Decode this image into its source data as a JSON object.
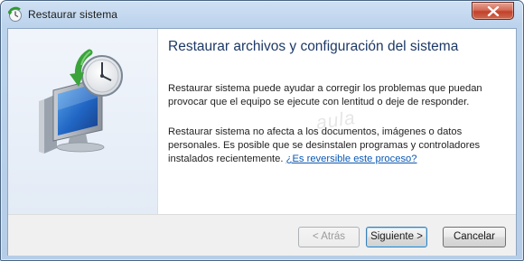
{
  "window": {
    "title": "Restaurar sistema"
  },
  "content": {
    "heading": "Restaurar archivos y configuración del sistema",
    "para1": "Restaurar sistema puede ayudar a corregir los problemas que puedan provocar que el equipo se ejecute con lentitud o deje de responder.",
    "para2_text": "Restaurar sistema no afecta a los documentos, imágenes o datos personales. Es posible que se desinstalen programas y controladores instalados recientemente.",
    "para2_link": "¿Es reversible este proceso?"
  },
  "watermark": "aula",
  "buttons": {
    "back": "< Atrás",
    "next": "Siguiente >",
    "cancel": "Cancelar"
  }
}
